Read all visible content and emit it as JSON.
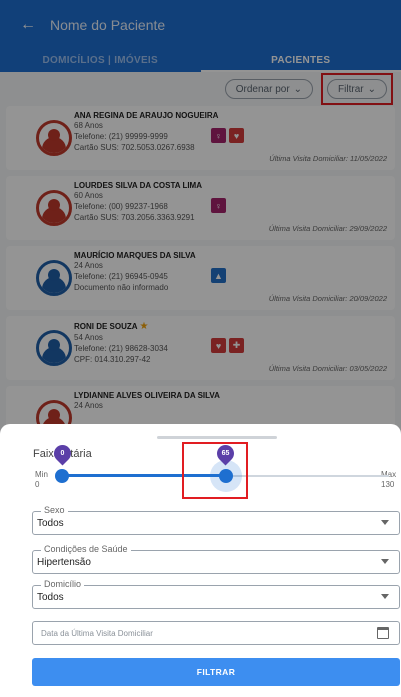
{
  "appbar": {
    "search_placeholder": "Nome do Paciente"
  },
  "tabs": [
    {
      "label": "DOMICÍLIOS | IMÓVEIS"
    },
    {
      "label": "PACIENTES"
    }
  ],
  "toolbar": {
    "sort_label": "Ordenar por",
    "filter_label": "Filtrar"
  },
  "patients": [
    {
      "name": "ANA REGINA DE ARAUJO NOGUEIRA",
      "age": "68 Anos",
      "phone": "Telefone: (21) 99999-9999",
      "doc": "Cartão SUS: 702.5053.0267.6938",
      "visit": "Última Visita Domiciliar: 11/05/2022"
    },
    {
      "name": "LOURDES SILVA DA COSTA LIMA",
      "age": "60 Anos",
      "phone": "Telefone: (00) 99237-1968",
      "doc": "Cartão SUS: 703.2056.3363.9291",
      "visit": "Última Visita Domiciliar: 29/09/2022"
    },
    {
      "name": "MAURÍCIO MARQUES DA SILVA",
      "age": "24 Anos",
      "phone": "Telefone: (21) 96945-0945",
      "doc": "Documento não informado",
      "visit": "Última Visita Domiciliar: 20/09/2022"
    },
    {
      "name": "RONI DE SOUZA",
      "age": "54 Anos",
      "phone": "Telefone: (21) 98628-3034",
      "doc": "CPF: 014.310.297-42",
      "visit": "Última Visita Domiciliar: 03/05/2022"
    },
    {
      "name": "LYDIANNE ALVES OLIVEIRA DA SILVA",
      "age": "24 Anos"
    }
  ],
  "filter_sheet": {
    "age_label": "Faixa Etária",
    "min_label": "Min",
    "min_value": "0",
    "max_label": "Max",
    "max_value": "130",
    "range_low": 0,
    "range_high": 65,
    "range_low_text": "0",
    "range_high_text": "65",
    "sex_label": "Sexo",
    "sex_value": "Todos",
    "health_label": "Condições de Saúde",
    "health_value": "Hipertensão",
    "home_label": "Domicílio",
    "home_value": "Todos",
    "date_placeholder": "Data da Última Visita Domiciliar",
    "submit_label": "FILTRAR"
  }
}
